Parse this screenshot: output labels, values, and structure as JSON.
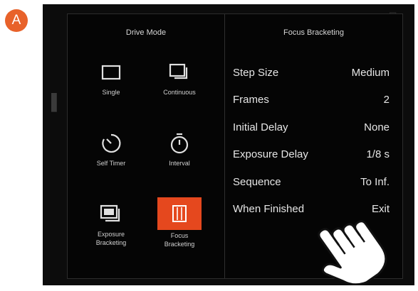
{
  "badge": {
    "label": "A",
    "color": "#e8622a"
  },
  "drive_mode": {
    "title": "Drive Mode",
    "modes": [
      {
        "label": "Single",
        "icon": "single-frame-icon",
        "selected": false
      },
      {
        "label": "Continuous",
        "icon": "continuous-icon",
        "selected": false
      },
      {
        "label": "Self Timer",
        "icon": "self-timer-icon",
        "selected": false
      },
      {
        "label": "Interval",
        "icon": "interval-icon",
        "selected": false
      },
      {
        "label": "Exposure\nBracketing",
        "icon": "exposure-bracketing-icon",
        "selected": false
      },
      {
        "label": "Focus\nBracketing",
        "icon": "focus-bracketing-icon",
        "selected": true
      }
    ]
  },
  "focus_bracketing": {
    "title": "Focus Bracketing",
    "settings": [
      {
        "label": "Step Size",
        "value": "Medium"
      },
      {
        "label": "Frames",
        "value": "2"
      },
      {
        "label": "Initial Delay",
        "value": "None"
      },
      {
        "label": "Exposure Delay",
        "value": "1/8 s"
      },
      {
        "label": "Sequence",
        "value": "To Inf."
      },
      {
        "label": "When Finished",
        "value": "Exit"
      }
    ]
  },
  "colors": {
    "accent": "#e5481e",
    "screen_bg": "#0c0c0c"
  }
}
